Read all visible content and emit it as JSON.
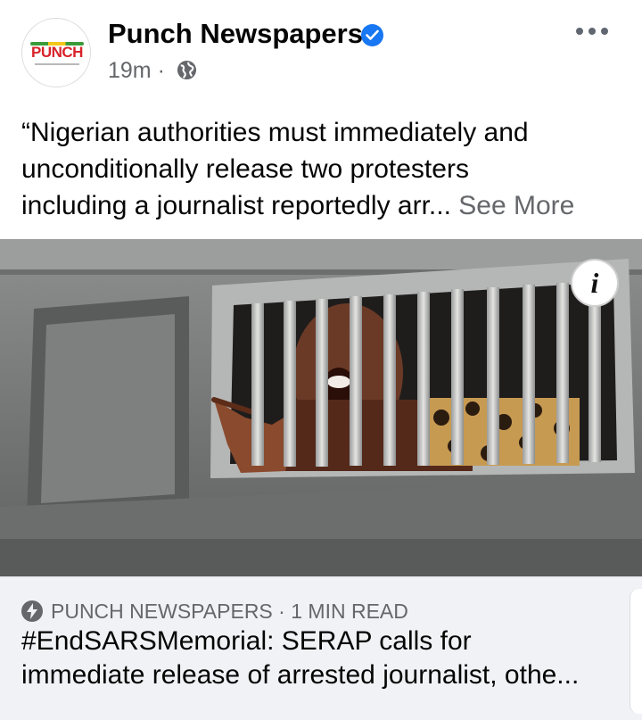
{
  "post": {
    "page_name": "Punch Newspapers",
    "avatar_logo_text": "PUNCH",
    "timestamp": "19m",
    "separator": "·",
    "audience_icon": "globe-icon",
    "verified_icon": "verified-badge-icon",
    "more_icon": "more-options-icon",
    "text_lines": [
      "“Nigerian authorities must immediately and",
      "unconditionally release two protesters",
      "including a journalist reportedly arr..."
    ],
    "see_more_label": "See More"
  },
  "photo": {
    "info_label": "i",
    "info_icon": "info-icon"
  },
  "link_card": {
    "source_icon": "bolt-icon",
    "source": "PUNCH NEWSPAPERS",
    "separator": "·",
    "read_time": "1 MIN READ",
    "headline_lines": [
      "#EndSARSMemorial: SERAP calls for",
      "immediate release of arrested journalist, othe..."
    ]
  },
  "colors": {
    "verified_blue": "#1877f2",
    "text_primary": "#050505",
    "text_secondary": "#65676b",
    "card_bg": "#f0f2f5",
    "logo_red": "#d8232a"
  }
}
